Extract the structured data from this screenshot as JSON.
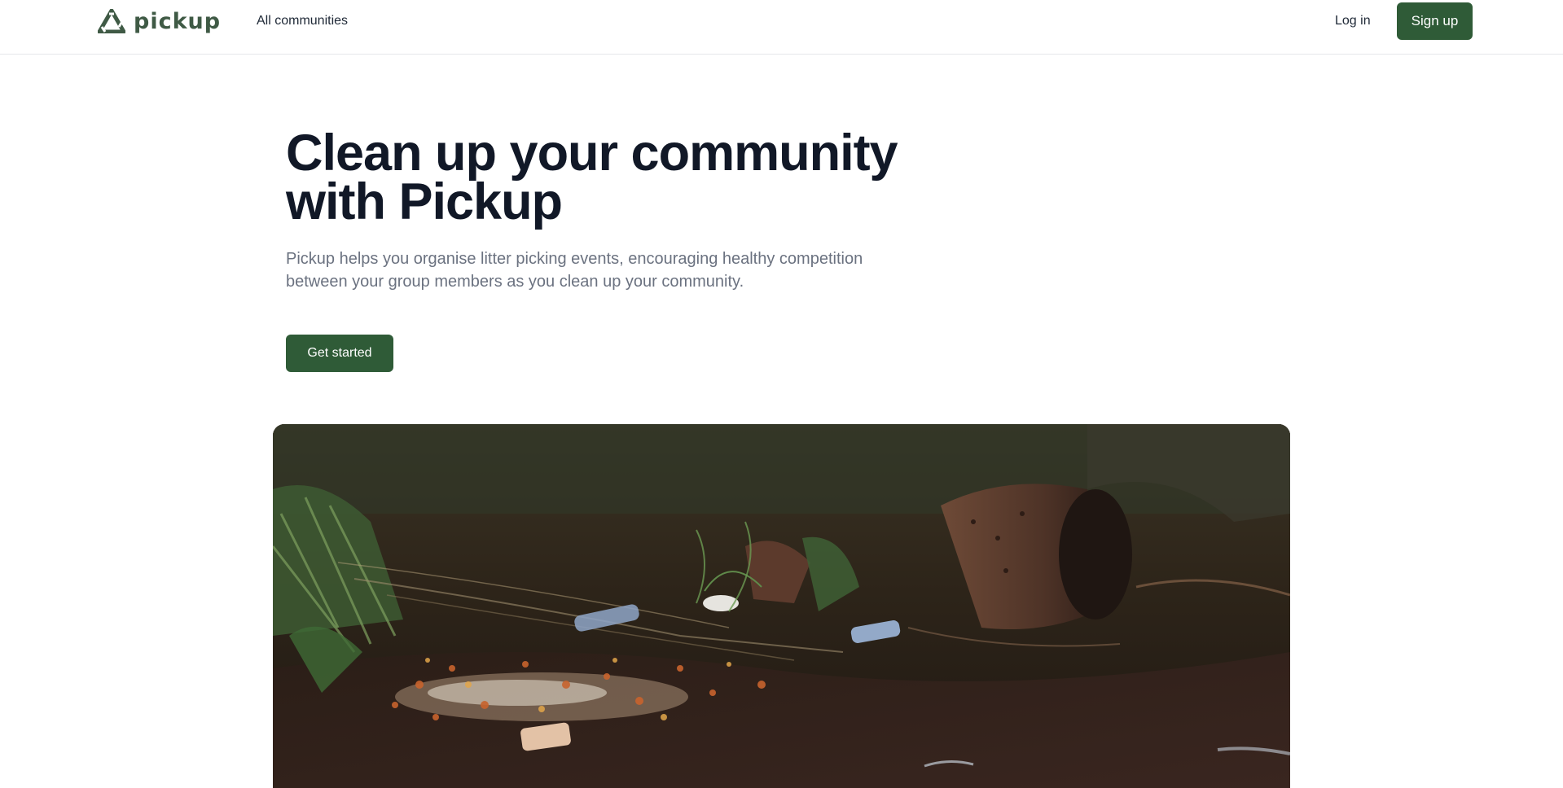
{
  "brand": {
    "name": "pickup",
    "icon": "recycle-triangle-icon",
    "color": "#3f5a45"
  },
  "nav": {
    "all_communities": "All communities",
    "login": "Log in",
    "signup": "Sign up"
  },
  "hero": {
    "title_line1": "Clean up your community",
    "title_line2": "with Pickup",
    "subtitle_line1": "Pickup helps you organise litter picking events, encouraging healthy competition",
    "subtitle_line2": "between your group members as you clean up your community.",
    "cta": "Get started"
  },
  "image": {
    "description_icon": "litter-stream-photo"
  },
  "colors": {
    "accent": "#2f5b37",
    "text": "#111827",
    "muted": "#6b7280",
    "border": "#e5e7eb"
  }
}
